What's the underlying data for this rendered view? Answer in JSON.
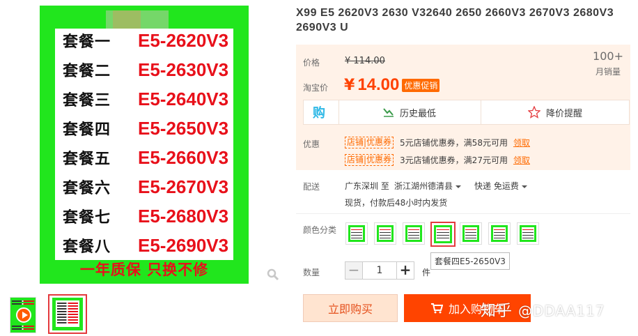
{
  "product_image": {
    "packages": [
      {
        "name": "套餐一",
        "model": "E5-2620V3"
      },
      {
        "name": "套餐二",
        "model": "E5-2630V3"
      },
      {
        "name": "套餐三",
        "model": "E5-2640V3"
      },
      {
        "name": "套餐四",
        "model": "E5-2650V3"
      },
      {
        "name": "套餐五",
        "model": "E5-2660V3"
      },
      {
        "name": "套餐六",
        "model": "E5-2670V3"
      },
      {
        "name": "套餐七",
        "model": "E5-2680V3"
      },
      {
        "name": "套餐八",
        "model": "E5-2690V3"
      }
    ],
    "warranty": "一年质保 只换不修"
  },
  "title": "X99 E5 2620V3 2630 V32640 2650 2660V3 2670V3 2680V3 2690V3 U",
  "price_section": {
    "price_label": "价格",
    "original_price": "¥ 114.00",
    "sales_count": "100+",
    "sales_label": "月销量",
    "taobao_price_label": "淘宝价",
    "currency": "¥",
    "current_price": "14.00",
    "promo_badge": "优惠促销",
    "history_lowest": "历史最低",
    "price_alert": "降价提醒"
  },
  "coupons": {
    "label": "优惠",
    "items": [
      {
        "tag": "店铺|优惠券",
        "text": "5元店铺优惠券，满58元可用",
        "action": "领取"
      },
      {
        "tag": "店铺|优惠券",
        "text": "3元店铺优惠券，满27元可用",
        "action": "领取"
      }
    ]
  },
  "delivery": {
    "label": "配送",
    "from": "广东深圳 至",
    "to": "浙江湖州德清县",
    "method": "快递 免运费",
    "note": "现货，付款后48小时内发货"
  },
  "color": {
    "label": "颜色分类",
    "selected_index": 3,
    "tooltip": "套餐四E5-2650V3"
  },
  "quantity": {
    "label": "数量",
    "minus": "−",
    "value": "1",
    "plus": "+",
    "unit": "件"
  },
  "actions": {
    "buy_now": "立即购买",
    "add_cart": "加入购物车"
  },
  "watermark": {
    "brand": "知乎",
    "user": "@DDAA117"
  },
  "colors": {
    "accent": "#ff4400",
    "image_green": "#21e61d",
    "model_red": "#e8101a",
    "price_orange": "#ff4200"
  }
}
